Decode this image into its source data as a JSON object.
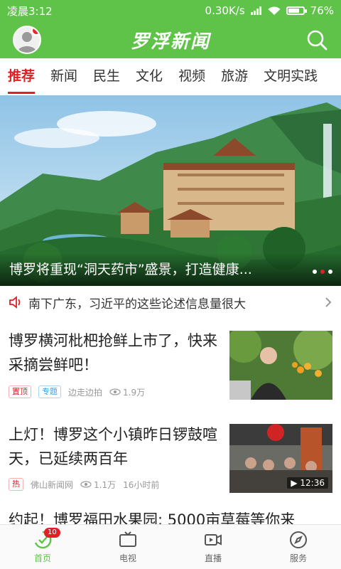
{
  "status": {
    "time": "凌晨3:12",
    "network_speed": "0.30K/s",
    "battery": "76%",
    "battery_level": 0.76
  },
  "app": {
    "title": "罗浮新闻"
  },
  "tabs": [
    {
      "label": "推荐",
      "active": true
    },
    {
      "label": "新闻"
    },
    {
      "label": "民生"
    },
    {
      "label": "文化"
    },
    {
      "label": "视频"
    },
    {
      "label": "旅游"
    },
    {
      "label": "文明实践"
    }
  ],
  "banner": {
    "caption": "博罗将重现“洞天药市”盛景，打造健康...",
    "dots": 3,
    "active_dot": 2
  },
  "notice": {
    "text": "南下广东，习近平的这些论述信息量很大"
  },
  "news": [
    {
      "title": "博罗横河枇杷抢鲜上市了，快来采摘尝鲜吧！",
      "tags": [
        {
          "label": "置顶",
          "color": "red"
        },
        {
          "label": "专题",
          "color": "blue"
        }
      ],
      "source": "边走边拍",
      "views": "1.9万",
      "time": ""
    },
    {
      "title": "上灯！博罗这个小镇昨日锣鼓喧天，已延续两百年",
      "tags": [
        {
          "label": "热",
          "color": "red"
        }
      ],
      "source": "佛山新闻网",
      "views": "1.1万",
      "time": "16小时前",
      "duration": "12:36"
    },
    {
      "title": "约起！博罗福田水果园: 5000亩草莓等你来"
    }
  ],
  "bottom_nav": [
    {
      "label": "首页",
      "active": true,
      "badge": "10",
      "icon": "home-icon"
    },
    {
      "label": "电视",
      "icon": "tv-icon"
    },
    {
      "label": "直播",
      "icon": "live-icon"
    },
    {
      "label": "服务",
      "icon": "compass-icon"
    }
  ],
  "colors": {
    "brand_green": "#5fc349",
    "accent_red": "#e21f25"
  }
}
